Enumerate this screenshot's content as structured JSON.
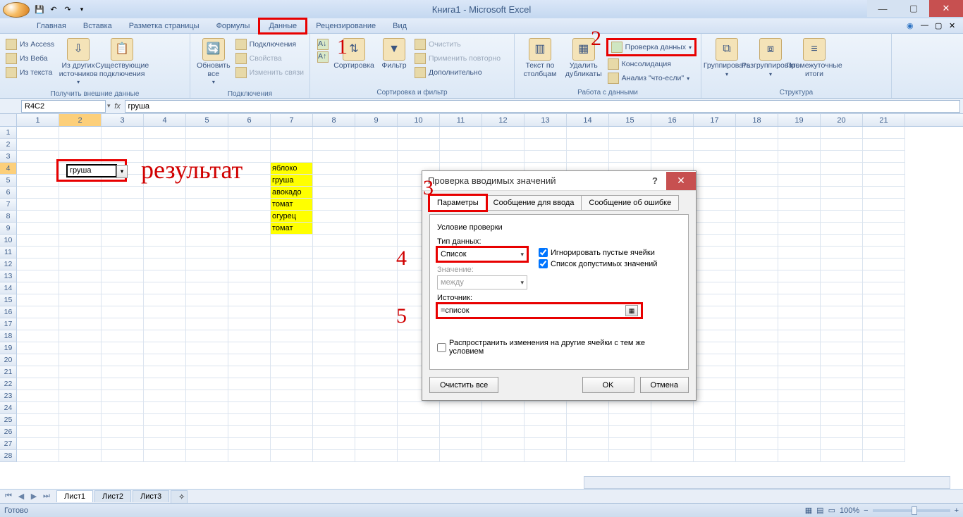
{
  "title": "Книга1 - Microsoft Excel",
  "menu": {
    "tabs": [
      "Главная",
      "Вставка",
      "Разметка страницы",
      "Формулы",
      "Данные",
      "Рецензирование",
      "Вид"
    ],
    "active": 4
  },
  "ribbon": {
    "group1": {
      "title": "Получить внешние данные",
      "access": "Из Access",
      "web": "Из Веба",
      "text": "Из текста",
      "other": "Из других источников",
      "existing": "Существующие подключения"
    },
    "group2": {
      "title": "Подключения",
      "refresh": "Обновить все",
      "conn": "Подключения",
      "props": "Свойства",
      "links": "Изменить связи"
    },
    "group3": {
      "title": "Сортировка и фильтр",
      "sort": "Сортировка",
      "filter": "Фильтр",
      "clear": "Очистить",
      "reapply": "Применить повторно",
      "adv": "Дополнительно"
    },
    "group4": {
      "title": "Работа с данными",
      "t2c": "Текст по столбцам",
      "dedup": "Удалить дубликаты",
      "validation": "Проверка данных",
      "consol": "Консолидация",
      "whatif": "Анализ \"что-если\""
    },
    "group5": {
      "title": "Структура",
      "group": "Группировать",
      "ungroup": "Разгруппировать",
      "subtotal": "Промежуточные итоги"
    }
  },
  "namebox": "R4C2",
  "fx": "груша",
  "annotations": {
    "n1": "1",
    "n2": "2",
    "n3": "3",
    "n4": "4",
    "n5": "5",
    "result": "результат"
  },
  "cells": {
    "selected": "груша",
    "list": [
      "яблоко",
      "груша",
      "авокадо",
      "томат",
      "огурец",
      "томат"
    ]
  },
  "dialog": {
    "title": "Проверка вводимых значений",
    "tabs": [
      "Параметры",
      "Сообщение для ввода",
      "Сообщение об ошибке"
    ],
    "cond_label": "Условие проверки",
    "type_label": "Тип данных:",
    "type_value": "Список",
    "value_label": "Значение:",
    "value_value": "между",
    "ignore_blank": "Игнорировать пустые ячейки",
    "in_cell": "Список допустимых значений",
    "source_label": "Источник:",
    "source_value": "=список",
    "propagate": "Распространить изменения на другие ячейки с тем же условием",
    "clear": "Очистить все",
    "ok": "OK",
    "cancel": "Отмена"
  },
  "sheets": {
    "s1": "Лист1",
    "s2": "Лист2",
    "s3": "Лист3"
  },
  "status": {
    "ready": "Готово",
    "zoom": "100%"
  }
}
